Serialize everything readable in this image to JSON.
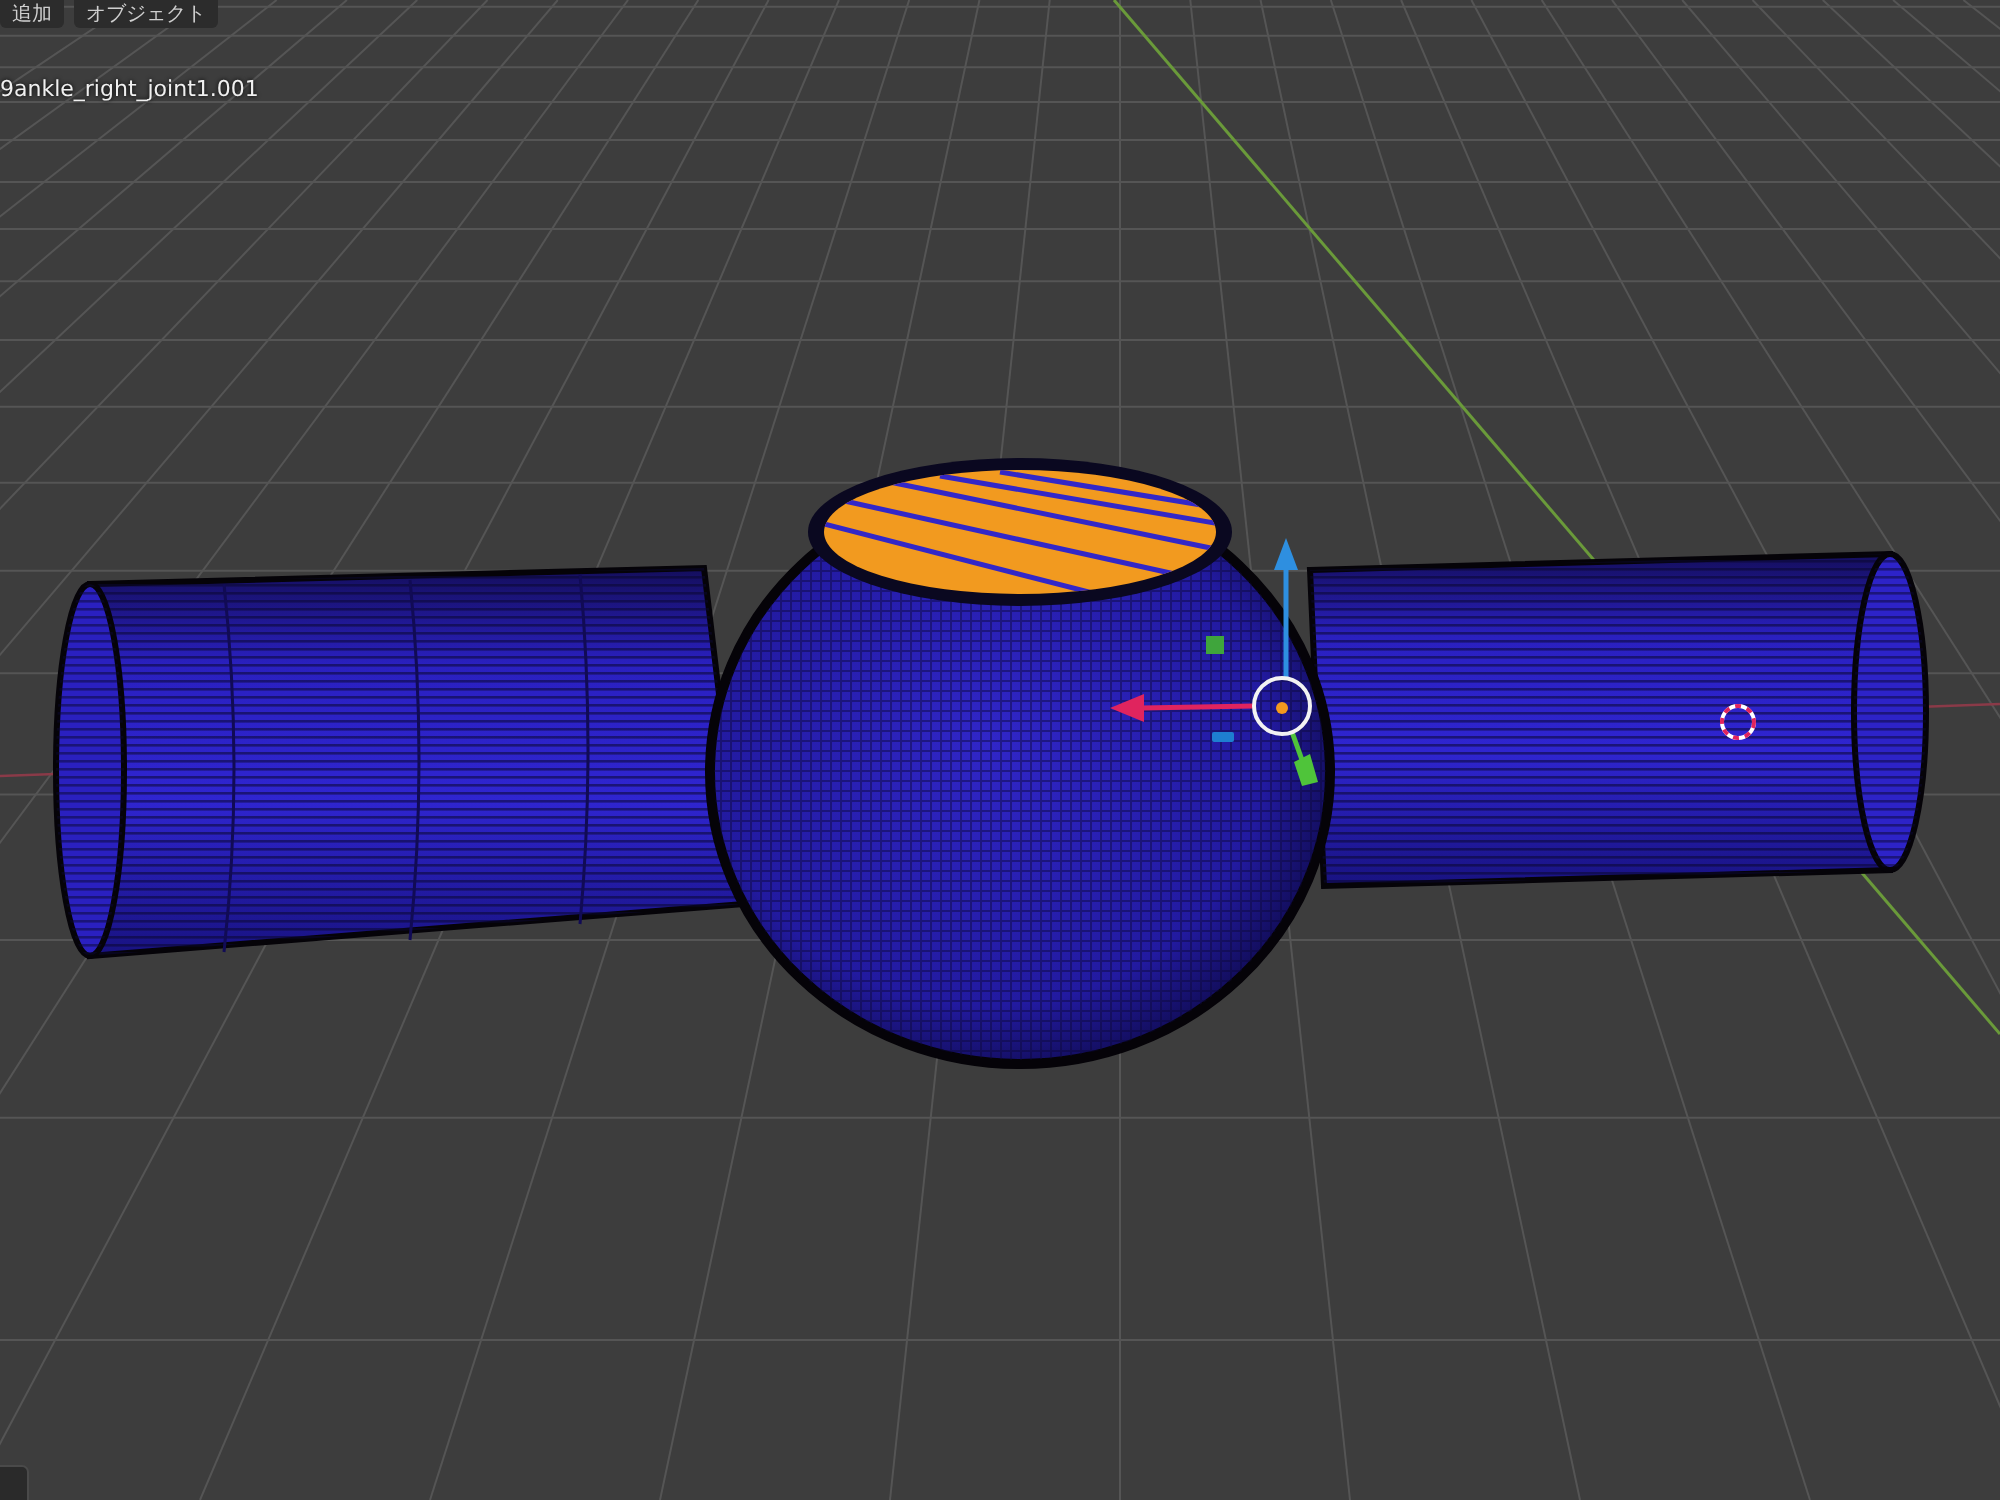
{
  "header": {
    "menus": [
      {
        "label": "追加"
      },
      {
        "label": "オブジェクト"
      }
    ]
  },
  "viewport": {
    "object_name": "9ankle_right_joint1.001"
  }
}
